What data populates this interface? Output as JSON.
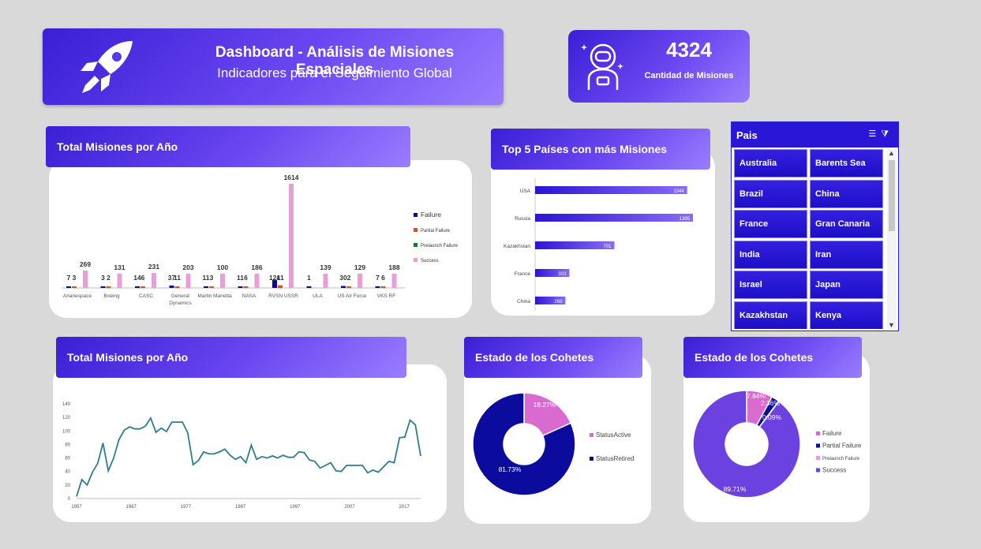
{
  "header": {
    "title": "Dashboard - Análisis de Misiones Espaciales",
    "subtitle": "Indicadores para el Seguimiento Global"
  },
  "kpi": {
    "value": "4324",
    "label": "Cantidad de Misiones"
  },
  "panels": {
    "bar_by_company_title": "Total Misiones por Año",
    "line_by_year_title": "Total Misiones por Año",
    "top_countries_title": "Top 5 Países con más Misiones",
    "rocket_status_title": "Estado de los Cohetes",
    "mission_status_title": "Estado de los Cohetes"
  },
  "slicer": {
    "title": "Pais",
    "items": [
      "Australia",
      "Barents Sea",
      "Brazil",
      "China",
      "France",
      "Gran Canaria",
      "India",
      "Iran",
      "Israel",
      "Japan",
      "Kazakhstan",
      "Kenya"
    ]
  },
  "colors": {
    "failure": "#0a0a9a",
    "partial_failure": "#d9531e",
    "prelaunch_failure": "#1a7a2a",
    "success": "#e79fd8",
    "line": "#2e7d8f",
    "status_active": "#d96ad0",
    "status_retired": "#0b0b9e",
    "donut_success": "#6b42e0"
  },
  "chart_data": [
    {
      "type": "bar",
      "title": "Total Misiones por Año",
      "categories": [
        "Arianespace",
        "Boeing",
        "CASC",
        "General Dynamics",
        "Martin Marietta",
        "NASA",
        "RVSN USSR",
        "ULA",
        "US Air Force",
        "VKS RF"
      ],
      "series": [
        {
          "name": "Failure",
          "values": [
            7,
            3,
            14,
            37,
            11,
            11,
            121,
            1,
            30,
            7
          ]
        },
        {
          "name": "Partial Failure",
          "values": [
            3,
            2,
            6,
            11,
            3,
            6,
            41,
            0,
            2,
            6
          ]
        },
        {
          "name": "Prelaunch Failure",
          "values": [
            0,
            0,
            0,
            0,
            0,
            0,
            0,
            0,
            0,
            0
          ]
        },
        {
          "name": "Success",
          "values": [
            269,
            131,
            231,
            203,
            100,
            186,
            1614,
            139,
            129,
            188
          ]
        }
      ],
      "labels_shown": [
        [
          "7",
          "3",
          "",
          "269"
        ],
        [
          "3",
          "2",
          "",
          "131"
        ],
        [
          "14",
          "6",
          "",
          "231"
        ],
        [
          "37",
          "11",
          "",
          "203"
        ],
        [
          "11",
          "3",
          "",
          "100"
        ],
        [
          "11",
          "6",
          "",
          "186"
        ],
        [
          "121",
          "41",
          "",
          "1614"
        ],
        [
          "1",
          "",
          "",
          "139"
        ],
        [
          "30",
          "2",
          "",
          "129"
        ],
        [
          "7",
          "6",
          "",
          "188"
        ]
      ],
      "ylim": [
        0,
        1614
      ],
      "legend": "right"
    },
    {
      "type": "bar",
      "orientation": "horizontal",
      "title": "Top 5 Países con más Misiones",
      "categories": [
        "USA",
        "Russia",
        "Kazakhstan",
        "France",
        "China"
      ],
      "values": [
        1344,
        1395,
        701,
        303,
        268
      ],
      "value_labels": [
        "1344",
        "1395",
        "701",
        "303",
        "268"
      ]
    },
    {
      "type": "line",
      "title": "Total Misiones por Año",
      "x": [
        1957,
        1958,
        1959,
        1960,
        1961,
        1962,
        1963,
        1964,
        1965,
        1966,
        1967,
        1968,
        1969,
        1970,
        1971,
        1972,
        1973,
        1974,
        1975,
        1976,
        1977,
        1978,
        1979,
        1980,
        1981,
        1982,
        1983,
        1984,
        1985,
        1986,
        1987,
        1988,
        1989,
        1990,
        1991,
        1992,
        1993,
        1994,
        1995,
        1996,
        1997,
        1998,
        1999,
        2000,
        2001,
        2002,
        2003,
        2004,
        2005,
        2006,
        2007,
        2008,
        2009,
        2010,
        2011,
        2012,
        2013,
        2014,
        2015,
        2016,
        2017,
        2018,
        2019,
        2020
      ],
      "values": [
        3,
        28,
        20,
        39,
        52,
        82,
        41,
        60,
        87,
        101,
        106,
        103,
        103,
        107,
        119,
        98,
        104,
        99,
        113,
        113,
        113,
        97,
        50,
        56,
        69,
        66,
        66,
        69,
        73,
        64,
        58,
        62,
        53,
        79,
        58,
        62,
        60,
        63,
        60,
        64,
        61,
        61,
        69,
        68,
        57,
        55,
        45,
        49,
        53,
        41,
        40,
        49,
        49,
        49,
        49,
        38,
        42,
        39,
        47,
        55,
        53,
        90,
        91,
        116,
        109,
        63
      ],
      "xticks": [
        "1957",
        "1967",
        "1977",
        "1987",
        "1997",
        "2007",
        "2017"
      ],
      "yticks": [
        "0",
        "20",
        "40",
        "60",
        "80",
        "100",
        "120",
        "140"
      ],
      "ylim": [
        0,
        140
      ]
    },
    {
      "type": "pie",
      "donut": true,
      "title": "Estado de los Cohetes",
      "labels": [
        "StatusActive",
        "StatusRetired"
      ],
      "values": [
        18.27,
        81.73
      ],
      "value_labels": [
        "18.27%",
        "81.73%"
      ],
      "legend": "right"
    },
    {
      "type": "pie",
      "donut": true,
      "title": "Estado de los Cohetes",
      "labels": [
        "Failure",
        "Partial Failure",
        "Prelaunch Failure",
        "Success"
      ],
      "values": [
        7.84,
        2.36,
        0.09,
        89.71
      ],
      "value_labels": [
        "7.84%",
        "2.36%",
        "0.09%",
        "89.71%"
      ],
      "legend": "right"
    }
  ]
}
